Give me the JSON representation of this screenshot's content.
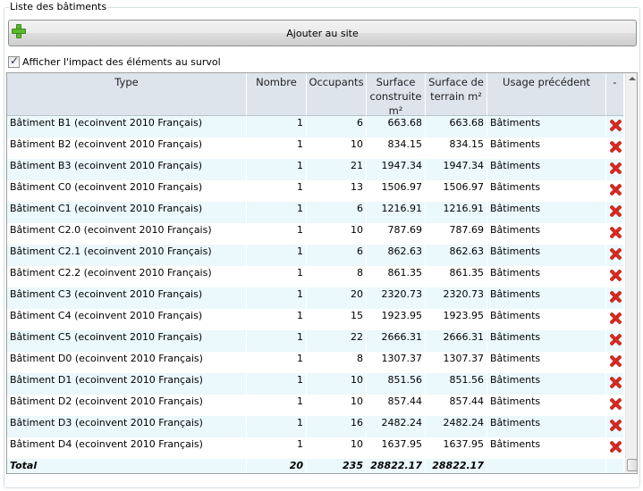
{
  "group": {
    "title": "Liste des bâtiments"
  },
  "add_button": {
    "label": "Ajouter au site"
  },
  "hover_checkbox": {
    "label": "Afficher l'impact des éléments au survol",
    "checked": true
  },
  "columns": {
    "type": "Type",
    "nombre": "Nombre",
    "occupants": "Occupants",
    "surface_construite": "Surface construite m²",
    "surface_terrain": "Surface de terrain m²",
    "usage": "Usage précédent",
    "delete": "-"
  },
  "rows": [
    {
      "type": "Bâtiment B1 (ecoinvent 2010 Français)",
      "nombre": "1",
      "occupants": "6",
      "surface_construite": "663.68",
      "surface_terrain": "663.68",
      "usage": "Bâtiments"
    },
    {
      "type": "Bâtiment B2 (ecoinvent 2010 Français)",
      "nombre": "1",
      "occupants": "10",
      "surface_construite": "834.15",
      "surface_terrain": "834.15",
      "usage": "Bâtiments"
    },
    {
      "type": "Bâtiment B3 (ecoinvent 2010 Français)",
      "nombre": "1",
      "occupants": "21",
      "surface_construite": "1947.34",
      "surface_terrain": "1947.34",
      "usage": "Bâtiments"
    },
    {
      "type": "Bâtiment C0 (ecoinvent 2010 Français)",
      "nombre": "1",
      "occupants": "13",
      "surface_construite": "1506.97",
      "surface_terrain": "1506.97",
      "usage": "Bâtiments"
    },
    {
      "type": "Bâtiment C1 (ecoinvent 2010 Français)",
      "nombre": "1",
      "occupants": "6",
      "surface_construite": "1216.91",
      "surface_terrain": "1216.91",
      "usage": "Bâtiments"
    },
    {
      "type": "Bâtiment C2.0 (ecoinvent 2010 Français)",
      "nombre": "1",
      "occupants": "10",
      "surface_construite": "787.69",
      "surface_terrain": "787.69",
      "usage": "Bâtiments"
    },
    {
      "type": "Bâtiment C2.1 (ecoinvent 2010 Français)",
      "nombre": "1",
      "occupants": "6",
      "surface_construite": "862.63",
      "surface_terrain": "862.63",
      "usage": "Bâtiments"
    },
    {
      "type": "Bâtiment C2.2 (ecoinvent 2010 Français)",
      "nombre": "1",
      "occupants": "8",
      "surface_construite": "861.35",
      "surface_terrain": "861.35",
      "usage": "Bâtiments"
    },
    {
      "type": "Bâtiment C3 (ecoinvent 2010 Français)",
      "nombre": "1",
      "occupants": "20",
      "surface_construite": "2320.73",
      "surface_terrain": "2320.73",
      "usage": "Bâtiments"
    },
    {
      "type": "Bâtiment C4 (ecoinvent 2010 Français)",
      "nombre": "1",
      "occupants": "15",
      "surface_construite": "1923.95",
      "surface_terrain": "1923.95",
      "usage": "Bâtiments"
    },
    {
      "type": "Bâtiment C5 (ecoinvent 2010 Français)",
      "nombre": "1",
      "occupants": "22",
      "surface_construite": "2666.31",
      "surface_terrain": "2666.31",
      "usage": "Bâtiments"
    },
    {
      "type": "Bâtiment D0 (ecoinvent 2010 Français)",
      "nombre": "1",
      "occupants": "8",
      "surface_construite": "1307.37",
      "surface_terrain": "1307.37",
      "usage": "Bâtiments"
    },
    {
      "type": "Bâtiment D1 (ecoinvent 2010 Français)",
      "nombre": "1",
      "occupants": "10",
      "surface_construite": "851.56",
      "surface_terrain": "851.56",
      "usage": "Bâtiments"
    },
    {
      "type": "Bâtiment D2 (ecoinvent 2010 Français)",
      "nombre": "1",
      "occupants": "10",
      "surface_construite": "857.44",
      "surface_terrain": "857.44",
      "usage": "Bâtiments"
    },
    {
      "type": "Bâtiment D3 (ecoinvent 2010 Français)",
      "nombre": "1",
      "occupants": "16",
      "surface_construite": "2482.24",
      "surface_terrain": "2482.24",
      "usage": "Bâtiments"
    },
    {
      "type": "Bâtiment D4 (ecoinvent 2010 Français)",
      "nombre": "1",
      "occupants": "10",
      "surface_construite": "1637.95",
      "surface_terrain": "1637.95",
      "usage": "Bâtiments"
    }
  ],
  "total": {
    "label": "Total",
    "nombre": "20",
    "occupants": "235",
    "surface_construite": "28822.17",
    "surface_terrain": "28822.17"
  },
  "colors": {
    "header_bg": "#dde4ec",
    "row_alt_bg": "#ebf8fc",
    "delete_icon": "#e02a20",
    "add_icon": "#5cb82e"
  },
  "icons": {
    "add": "plus-icon",
    "delete": "delete-x-icon",
    "check": "checkmark-icon"
  }
}
